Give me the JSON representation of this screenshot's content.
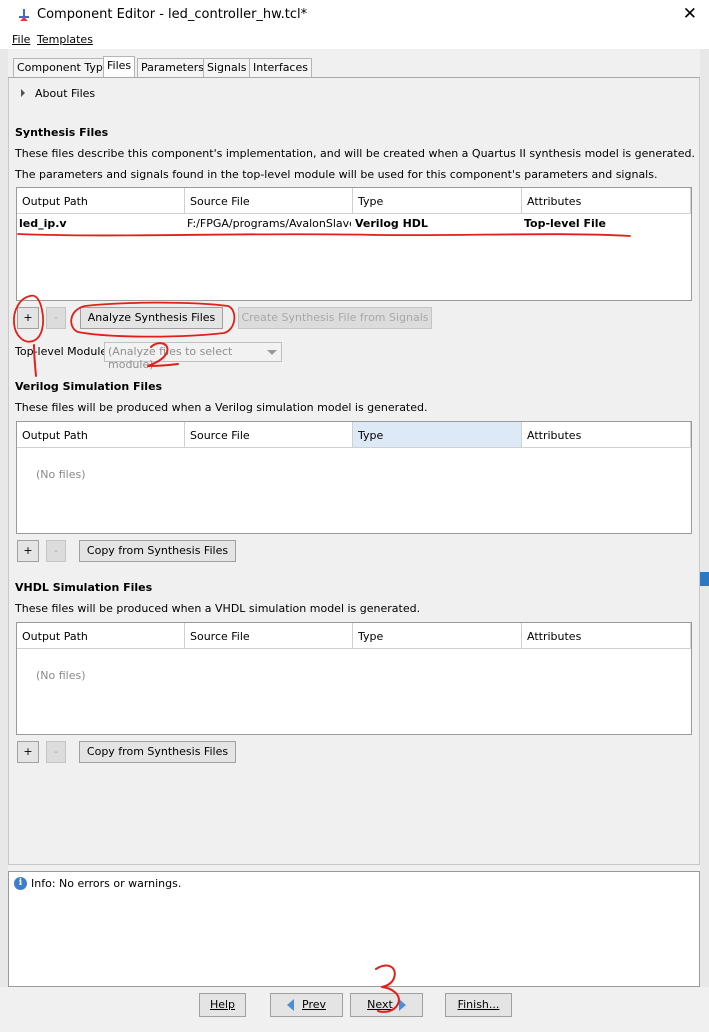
{
  "window": {
    "title": "Component Editor - led_controller_hw.tcl*",
    "close_glyph": "✕"
  },
  "menu": {
    "file": "File",
    "templates": "Templates"
  },
  "tabs": [
    "Component Type",
    "Files",
    "Parameters",
    "Signals",
    "Interfaces"
  ],
  "active_tab": "Files",
  "about_files": "About Files",
  "synthesis": {
    "title": "Synthesis Files",
    "desc1": "These files describe this component's implementation, and will be created when a Quartus II synthesis model is generated.",
    "desc2": "The parameters and signals found in the top-level module will be used for this component's parameters and signals.",
    "columns": [
      "Output Path",
      "Source File",
      "Type",
      "Attributes"
    ],
    "rows": [
      {
        "output_path": "led_ip.v",
        "source_file": "F:/FPGA/programs/AvalonSlave...",
        "type": "Verilog HDL",
        "attributes": "Top-level File"
      }
    ],
    "add_label": "+",
    "remove_label": "-",
    "analyze_label": "Analyze Synthesis Files",
    "create_label": "Create Synthesis File from Signals",
    "top_level_label": "Top-level Module:",
    "top_level_value": "(Analyze files to select module)"
  },
  "verilog_sim": {
    "title": "Verilog Simulation Files",
    "desc": "These files will be produced when a Verilog simulation model is generated.",
    "columns": [
      "Output Path",
      "Source File",
      "Type",
      "Attributes"
    ],
    "empty_text": "(No files)",
    "add_label": "+",
    "remove_label": "-",
    "copy_label": "Copy from Synthesis Files"
  },
  "vhdl_sim": {
    "title": "VHDL Simulation Files",
    "desc": "These files will be produced when a VHDL simulation model is generated.",
    "columns": [
      "Output Path",
      "Source File",
      "Type",
      "Attributes"
    ],
    "empty_text": "(No files)",
    "add_label": "+",
    "remove_label": "-",
    "copy_label": "Copy from Synthesis Files"
  },
  "messages": {
    "info_text": "Info: No errors or warnings."
  },
  "nav": {
    "help": "Help",
    "prev": "Prev",
    "next": "Next",
    "finish": "Finish..."
  },
  "annotations": {
    "label_1": "1",
    "label_2": "2",
    "label_3": "3",
    "color": "#e0201a"
  }
}
